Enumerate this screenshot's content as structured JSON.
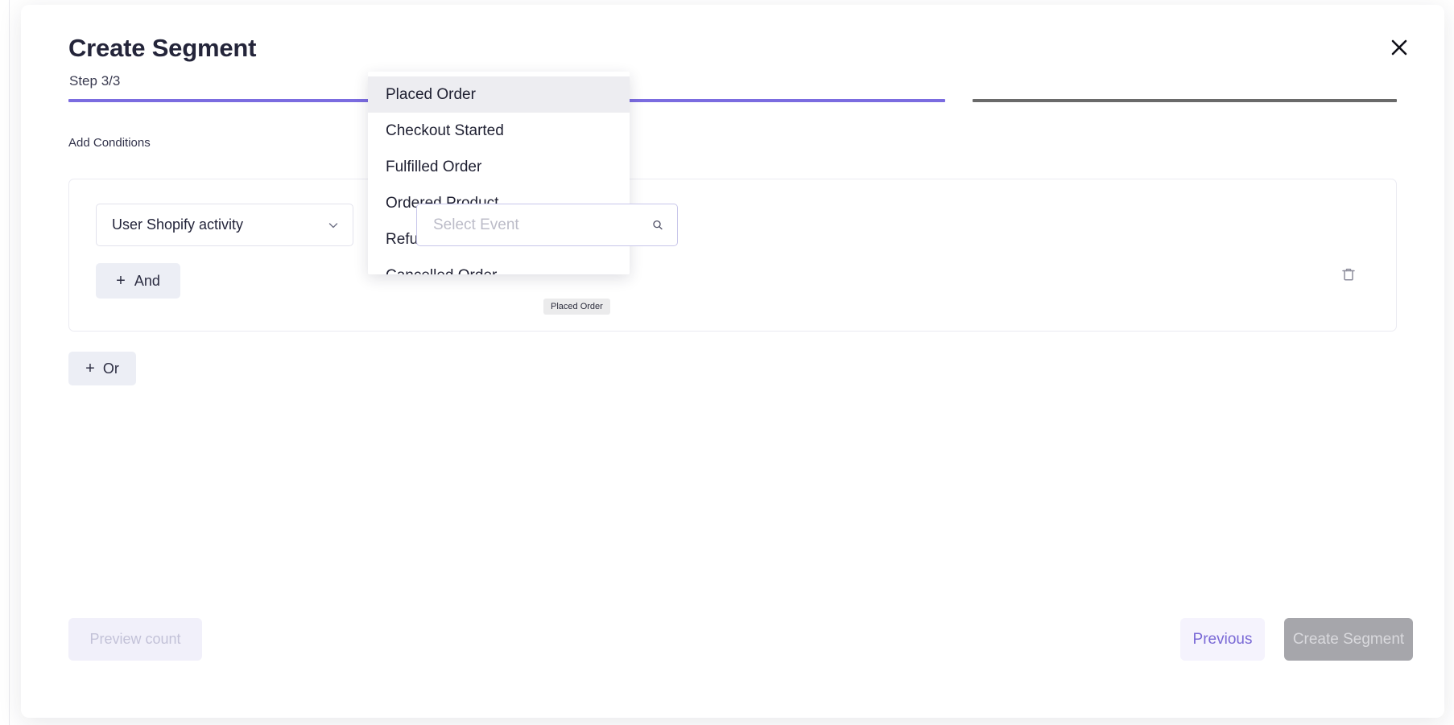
{
  "modal": {
    "title": "Create Segment",
    "step_label": "Step 3/3",
    "close_icon": "close-icon"
  },
  "progress": {
    "segments": [
      {
        "color": "#7b6ce0",
        "state": "complete"
      },
      {
        "color": "#7b6ce0",
        "state": "complete"
      },
      {
        "color": "#6a6a6a",
        "state": "current"
      }
    ]
  },
  "body": {
    "section_label": "Add Conditions",
    "condition": {
      "source_select": {
        "value": "User Shopify activity",
        "chevron_icon": "chevron-down-icon"
      },
      "event_search": {
        "value": "",
        "placeholder": "Select Event",
        "search_icon": "search-icon"
      },
      "and_button": {
        "label": "And",
        "plus": "+"
      },
      "delete_icon": "trash-icon"
    },
    "or_button": {
      "label": "Or",
      "plus": "+"
    }
  },
  "dropdown": {
    "items": [
      {
        "label": "Placed Order",
        "highlighted": true
      },
      {
        "label": "Checkout Started",
        "highlighted": false
      },
      {
        "label": "Fulfilled Order",
        "highlighted": false
      },
      {
        "label": "Ordered Product",
        "highlighted": false
      },
      {
        "label": "Refunded Order",
        "highlighted": false
      },
      {
        "label": "Cancelled Order",
        "highlighted": false
      }
    ]
  },
  "tooltip": {
    "text": "Placed Order"
  },
  "footer": {
    "preview_label": "Preview count",
    "previous_label": "Previous",
    "create_label": "Create Segment"
  },
  "colors": {
    "accent": "#7b6ce0",
    "progress_current": "#6a6a6a",
    "disabled_button": "#a6a6ab"
  }
}
